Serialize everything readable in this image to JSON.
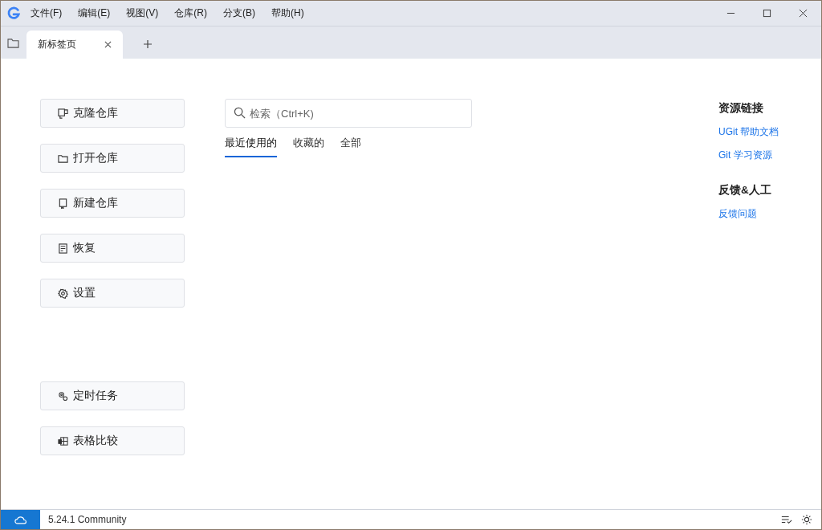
{
  "menu": [
    "文件(F)",
    "编辑(E)",
    "视图(V)",
    "仓库(R)",
    "分支(B)",
    "帮助(H)"
  ],
  "tabs": [
    {
      "label": "新标签页",
      "selected": true
    }
  ],
  "actions": [
    "克隆仓库",
    "打开仓库",
    "新建仓库",
    "恢复",
    "设置"
  ],
  "bottom_actions": [
    "定时任务",
    "表格比较"
  ],
  "search": {
    "placeholder": "检索（Ctrl+K)"
  },
  "filters": [
    {
      "label": "最近使用的",
      "selected": true
    },
    {
      "label": "收藏的",
      "selected": false
    },
    {
      "label": "全部",
      "selected": false
    }
  ],
  "sections": [
    {
      "title": "资源链接",
      "links": [
        "UGit 帮助文档",
        "Git 学习资源"
      ]
    },
    {
      "title": "反馈&人工",
      "links": [
        "反馈问题"
      ]
    }
  ],
  "status_bar": {
    "version": "5.24.1 Community"
  }
}
